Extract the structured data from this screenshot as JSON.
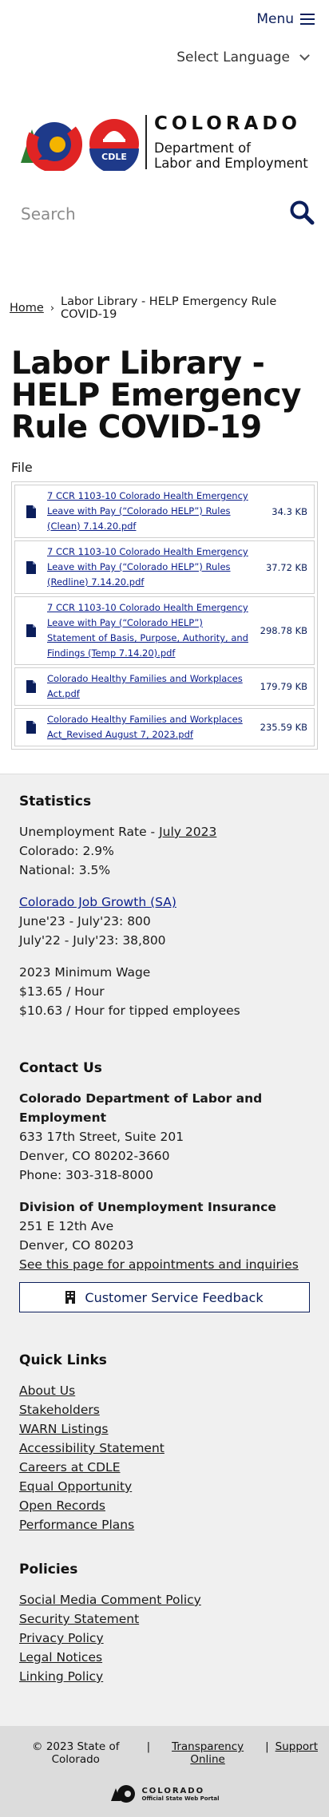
{
  "header": {
    "menu_label": "Menu",
    "language_label": "Select Language"
  },
  "logo": {
    "colorado_text": "COLORADO",
    "dept_line1": "Department of",
    "dept_line2": "Labor and Employment",
    "badge_text": "CDLE"
  },
  "search": {
    "placeholder": "Search"
  },
  "breadcrumb": {
    "home": "Home",
    "separator": "›",
    "current": "Labor Library - HELP Emergency Rule COVID-19"
  },
  "page": {
    "title": "Labor Library - HELP Emergency Rule COVID-19",
    "file_label": "File"
  },
  "files": [
    {
      "name": "7 CCR 1103-10 Colorado Health Emergency Leave with Pay (“Colorado HELP”) Rules (Clean) 7.14.20.pdf",
      "size": "34.3 KB"
    },
    {
      "name": "7 CCR 1103-10 Colorado Health Emergency Leave with Pay (“Colorado HELP”) Rules (Redline) 7.14.20.pdf",
      "size": "37.72 KB"
    },
    {
      "name": "7 CCR 1103-10 Colorado Health Emergency Leave with Pay (“Colorado HELP”) Statement of Basis, Purpose, Authority, and Findings (Temp 7.14.20).pdf",
      "size": "298.78 KB"
    },
    {
      "name": "Colorado Healthy Families and Workplaces Act.pdf",
      "size": "179.79 KB"
    },
    {
      "name": "Colorado Healthy Families and Workplaces Act_Revised August 7, 2023.pdf",
      "size": "235.59 KB"
    }
  ],
  "statistics": {
    "heading": "Statistics",
    "unemployment_prefix": "Unemployment Rate - ",
    "unemployment_link": "July 2023",
    "colorado": "Colorado: 2.9%",
    "national": "National: 3.5%",
    "job_growth_link": "Colorado Job Growth (SA)",
    "job_growth_1": "June'23 - July'23: 800",
    "job_growth_2": "July'22 - July'23: 38,800",
    "min_wage_heading": "2023 Minimum Wage",
    "min_wage_1": "$13.65 / Hour",
    "min_wage_2": "$10.63 / Hour for tipped employees"
  },
  "contact": {
    "heading": "Contact Us",
    "org_name": "Colorado Department of Labor and Employment",
    "address1": "633 17th Street, Suite 201",
    "address2": "Denver, CO  80202-3660",
    "phone": "Phone: 303-318-8000",
    "division_name": "Division of Unemployment Insurance",
    "div_address1": "251 E 12th Ave",
    "div_address2": "Denver, CO  80203",
    "div_link": "See this page for appointments and inquiries",
    "feedback_button": "Customer Service Feedback"
  },
  "quick_links": {
    "heading": "Quick Links",
    "items": [
      "About Us",
      "Stakeholders",
      "WARN Listings",
      "Accessibility Statement",
      "Careers at CDLE",
      "Equal Opportunity",
      "Open Records",
      "Performance Plans"
    ]
  },
  "policies": {
    "heading": "Policies",
    "items": [
      "Social Media Comment Policy",
      "Security Statement",
      "Privacy Policy",
      "Legal Notices",
      "Linking Policy"
    ]
  },
  "bottom": {
    "copyright": "© 2023 State of Colorado",
    "sep": "|",
    "transparency": "Transparency Online",
    "support": "Support",
    "portal_line1": "COLORADO",
    "portal_line2": "Official State Web Portal"
  },
  "colors": {
    "navy": "#0b1e5b",
    "link_blue": "#0b1e8b",
    "footer_bg": "#f0f0f0",
    "bottom_bg": "#dcdcdc"
  }
}
